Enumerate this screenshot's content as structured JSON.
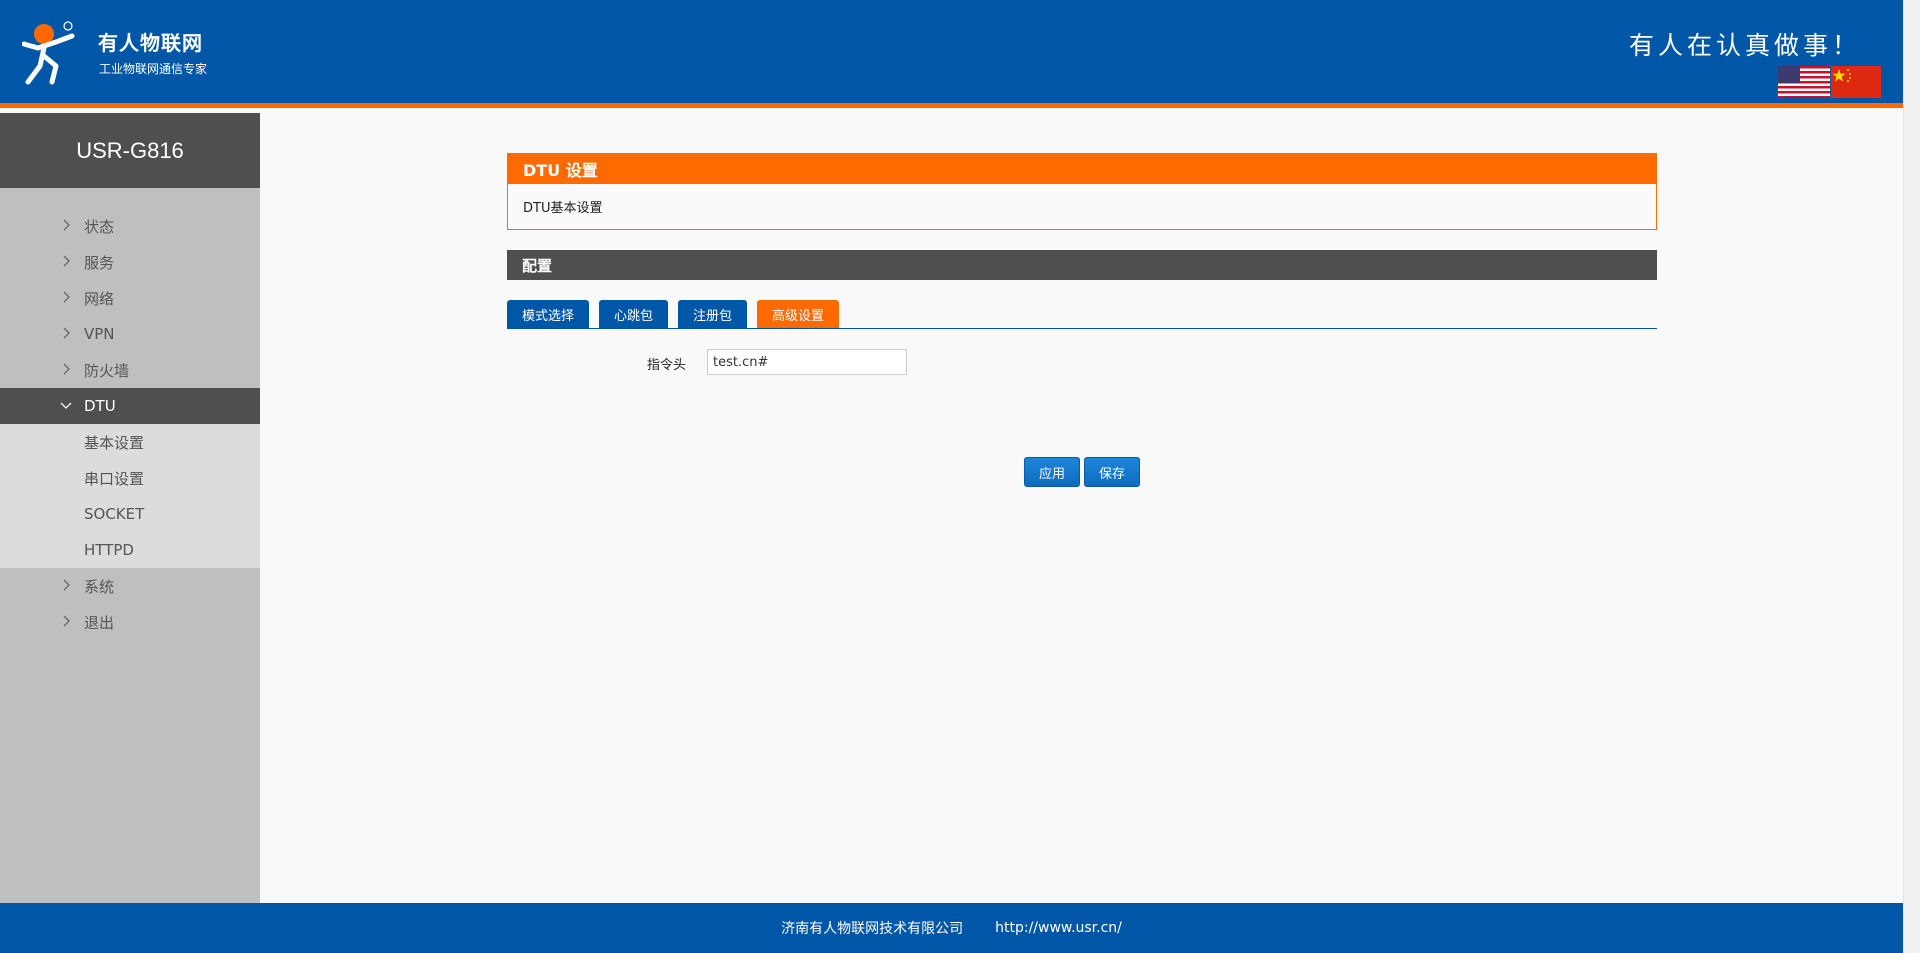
{
  "header": {
    "brand_name": "有人物联网",
    "brand_sub": "工业物联网通信专家",
    "slogan": "有人在认真做事！",
    "colors": {
      "primary": "#0157a7",
      "accent": "#ff6a00"
    }
  },
  "sidebar": {
    "title": "USR-G816",
    "items": [
      {
        "label": "状态"
      },
      {
        "label": "服务"
      },
      {
        "label": "网络"
      },
      {
        "label": "VPN"
      },
      {
        "label": "防火墙"
      },
      {
        "label": "DTU"
      }
    ],
    "sub_items": [
      {
        "label": "基本设置"
      },
      {
        "label": "串口设置"
      },
      {
        "label": "SOCKET"
      },
      {
        "label": "HTTPD"
      }
    ],
    "items_after": [
      {
        "label": "系统"
      },
      {
        "label": "退出"
      }
    ]
  },
  "main": {
    "section_title": "DTU 设置",
    "section_desc": "DTU基本设置",
    "config_title": "配置",
    "tabs": [
      {
        "label": "模式选择"
      },
      {
        "label": "心跳包"
      },
      {
        "label": "注册包"
      },
      {
        "label": "高级设置"
      }
    ],
    "field": {
      "label": "指令头",
      "value": "test.cn#"
    },
    "apply_label": "应用",
    "save_label": "保存"
  },
  "footer": {
    "company": "济南有人物联网技术有限公司",
    "url": "http://www.usr.cn/"
  }
}
